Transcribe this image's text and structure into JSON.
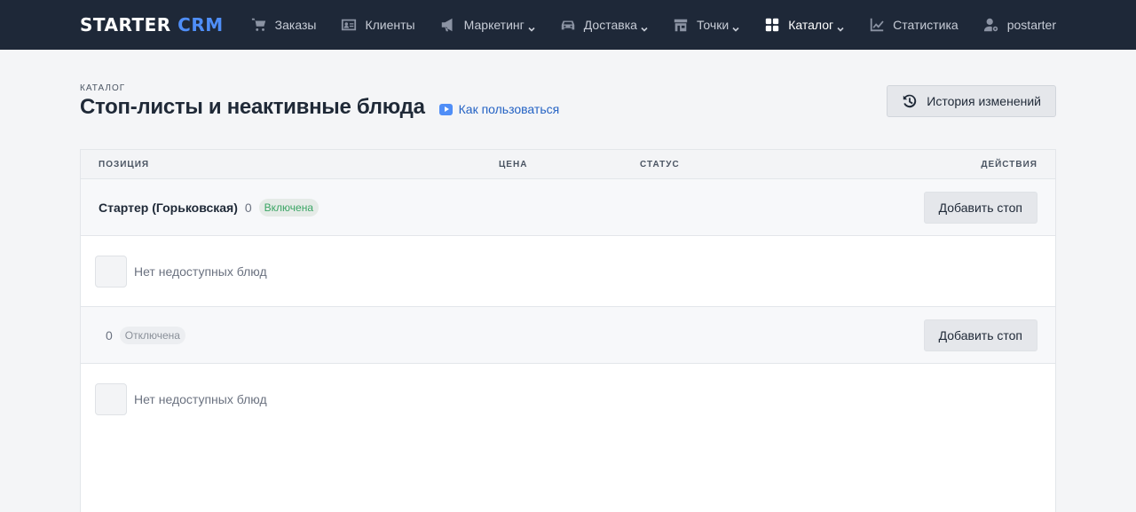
{
  "brand": {
    "name": "STARTER",
    "accent": "CRM"
  },
  "nav": [
    {
      "label": "Заказы",
      "icon": "cart-icon",
      "dropdown": false,
      "active": false
    },
    {
      "label": "Клиенты",
      "icon": "id-card-icon",
      "dropdown": false,
      "active": false
    },
    {
      "label": "Маркетинг",
      "icon": "megaphone-icon",
      "dropdown": true,
      "active": false
    },
    {
      "label": "Доставка",
      "icon": "car-icon",
      "dropdown": true,
      "active": false
    },
    {
      "label": "Точки",
      "icon": "store-icon",
      "dropdown": true,
      "active": false
    },
    {
      "label": "Каталог",
      "icon": "grid-icon",
      "dropdown": true,
      "active": true
    },
    {
      "label": "Статистика",
      "icon": "chart-line-icon",
      "dropdown": false,
      "active": false
    },
    {
      "label": "postarter",
      "icon": "user-gear-icon",
      "dropdown": false,
      "active": false
    }
  ],
  "header": {
    "breadcrumb": "КАТАЛОГ",
    "title": "Стоп-листы и неактивные блюда",
    "howto_label": "Как пользоваться",
    "history_label": "История изменений"
  },
  "table": {
    "columns": {
      "position": "ПОЗИЦИЯ",
      "price": "ЦЕНА",
      "status": "СТАТУС",
      "actions": "ДЕЙСТВИЯ"
    },
    "groups": [
      {
        "name": "Стартер (Горьковская)",
        "count": "0",
        "status": "Включена",
        "add_label": "Добавить стоп",
        "empty_text": "Нет недоступных блюд"
      },
      {
        "name": "",
        "count": "0",
        "status": "Отключена",
        "add_label": "Добавить стоп",
        "empty_text": "Нет недоступных блюд"
      }
    ]
  },
  "colors": {
    "topbar": "#1e2838",
    "accent": "#4f8ef7",
    "status_on": "#3aa564",
    "status_off": "#8a9099",
    "link": "#2563c4"
  }
}
